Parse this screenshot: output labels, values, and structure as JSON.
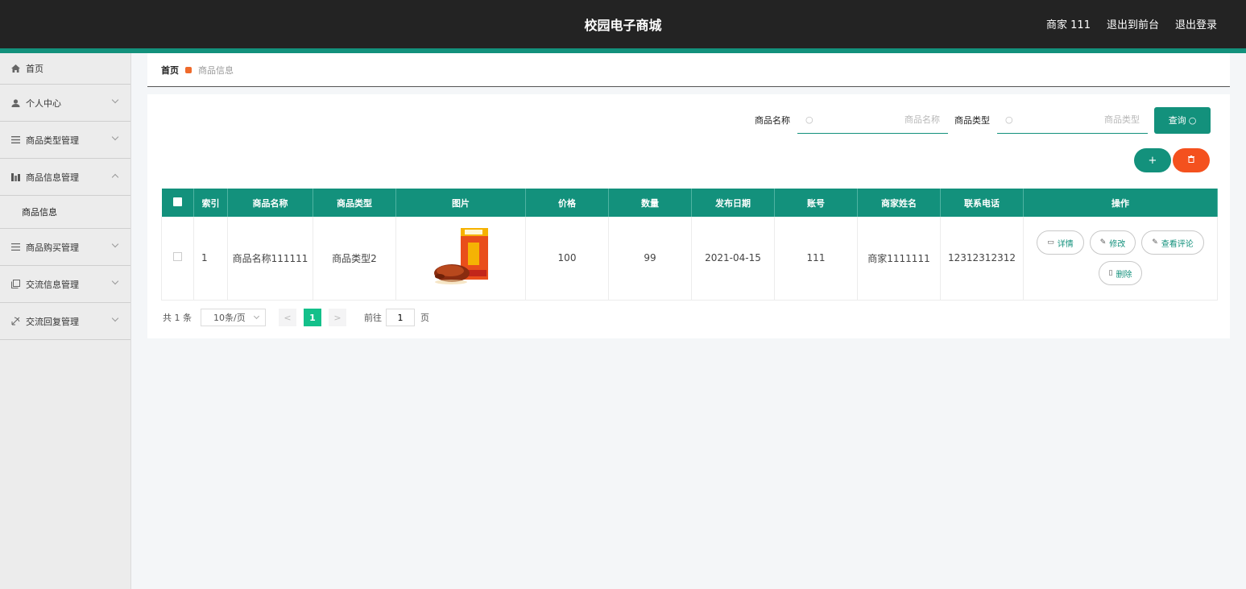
{
  "app": {
    "title": "校园电子商城"
  },
  "header": {
    "user": "商家 111",
    "front": "退出到前台",
    "logout": "退出登录"
  },
  "sidebar": {
    "items": [
      {
        "label": "首页",
        "icon": "home-icon"
      },
      {
        "label": "个人中心",
        "icon": "user-icon"
      },
      {
        "label": "商品类型管理",
        "icon": "list-icon"
      },
      {
        "label": "商品信息管理",
        "icon": "chart-icon",
        "expanded": true,
        "children": [
          {
            "label": "商品信息"
          }
        ]
      },
      {
        "label": "商品购买管理",
        "icon": "menu-icon"
      },
      {
        "label": "交流信息管理",
        "icon": "copy-icon"
      },
      {
        "label": "交流回复管理",
        "icon": "reply-icon"
      }
    ]
  },
  "breadcrumb": {
    "home": "首页",
    "current": "商品信息"
  },
  "search": {
    "name_label": "商品名称",
    "name_placeholder": "商品名称",
    "type_label": "商品类型",
    "type_placeholder": "商品类型",
    "query_label": "查询 ",
    "add_label": "+",
    "delete_label": "删"
  },
  "table": {
    "columns": [
      "索引",
      "商品名称",
      "商品类型",
      "图片",
      "价格",
      "数量",
      "发布日期",
      "账号",
      "商家姓名",
      "联系电话",
      "操作"
    ],
    "rows": [
      {
        "index": "1",
        "name": "商品名称111111",
        "type": "商品类型2",
        "image": "roast-duck-product",
        "price": "100",
        "qty": "99",
        "date": "2021-04-15",
        "account": "111",
        "merchant": "商家1111111",
        "phone": "12312312312"
      }
    ],
    "actions": {
      "detail": "详情",
      "edit": "修改",
      "comments": "查看评论",
      "delete": "删除"
    }
  },
  "pagination": {
    "total": "共 1 条",
    "page_size": "10条/页",
    "current": "1",
    "goto": "前往",
    "goto_value": "1",
    "page_unit": "页"
  },
  "colors": {
    "accent": "#13917c",
    "danger": "#f4511e",
    "header_bg": "#232323"
  }
}
